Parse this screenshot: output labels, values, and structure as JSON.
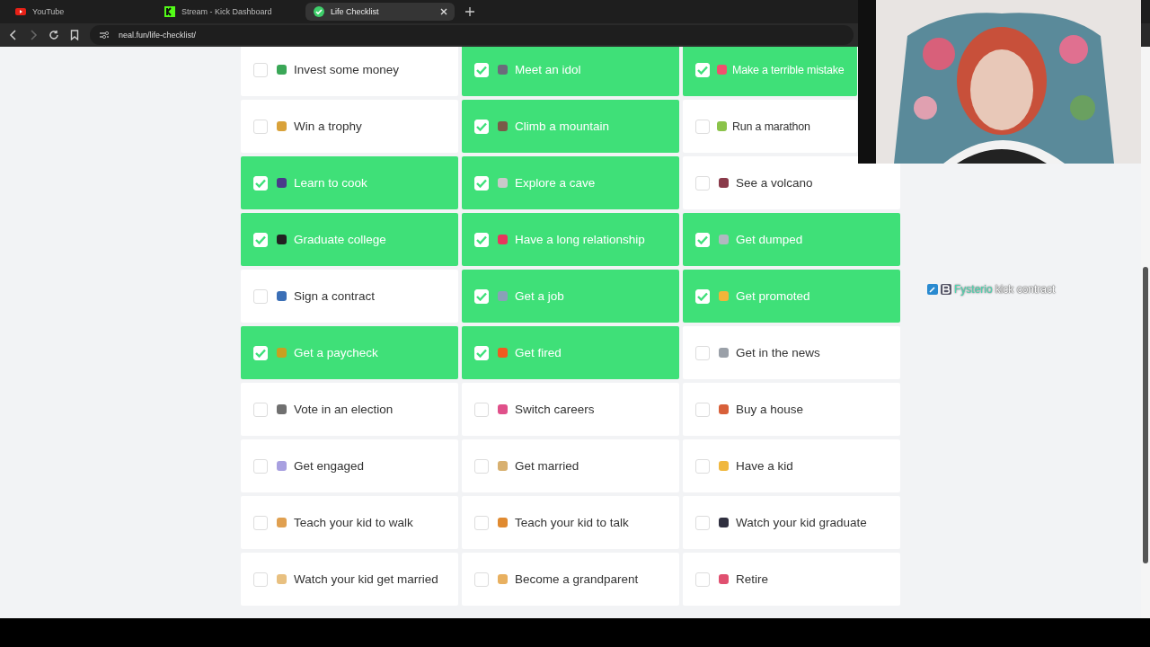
{
  "browser": {
    "tabs": [
      {
        "title": "YouTube",
        "selected": false,
        "kind": "youtube"
      },
      {
        "title": "Stream - Kick Dashboard",
        "selected": false,
        "kind": "kick"
      },
      {
        "title": "Life Checklist",
        "selected": true,
        "kind": "check"
      }
    ],
    "address": "neal.fun/life-checklist/"
  },
  "checklist": [
    {
      "label": "Invest some money",
      "checked": false,
      "color": "#3aa757"
    },
    {
      "label": "Meet an idol",
      "checked": true,
      "color": "#6b6b7b"
    },
    {
      "label": "Make a terrible mistake",
      "checked": true,
      "color": "#f0506e"
    },
    {
      "label": "Win a trophy",
      "checked": false,
      "color": "#d9a23a"
    },
    {
      "label": "Climb a mountain",
      "checked": true,
      "color": "#7a5a48"
    },
    {
      "label": "Run a marathon",
      "checked": false,
      "color": "#8bc34a"
    },
    {
      "label": "Learn to cook",
      "checked": true,
      "color": "#4a3a8a"
    },
    {
      "label": "Explore a cave",
      "checked": true,
      "color": "#c9c9c9"
    },
    {
      "label": "See a volcano",
      "checked": false,
      "color": "#8a3a4a"
    },
    {
      "label": "Graduate college",
      "checked": true,
      "color": "#222222"
    },
    {
      "label": "Have a long relationship",
      "checked": true,
      "color": "#e8365d"
    },
    {
      "label": "Get dumped",
      "checked": true,
      "color": "#b0b8c0"
    },
    {
      "label": "Sign a contract",
      "checked": false,
      "color": "#3b6fb6"
    },
    {
      "label": "Get a job",
      "checked": true,
      "color": "#8aa0b8"
    },
    {
      "label": "Get promoted",
      "checked": true,
      "color": "#f2b53a"
    },
    {
      "label": "Get a paycheck",
      "checked": true,
      "color": "#c8a020"
    },
    {
      "label": "Get fired",
      "checked": true,
      "color": "#f05a20"
    },
    {
      "label": "Get in the news",
      "checked": false,
      "color": "#9aa0a8"
    },
    {
      "label": "Vote in an election",
      "checked": false,
      "color": "#707070"
    },
    {
      "label": "Switch careers",
      "checked": false,
      "color": "#e0508a"
    },
    {
      "label": "Buy a house",
      "checked": false,
      "color": "#d8603a"
    },
    {
      "label": "Get engaged",
      "checked": false,
      "color": "#a8a0e0"
    },
    {
      "label": "Get married",
      "checked": false,
      "color": "#d8b070"
    },
    {
      "label": "Have a kid",
      "checked": false,
      "color": "#f0b840"
    },
    {
      "label": "Teach your kid to walk",
      "checked": false,
      "color": "#e0a050"
    },
    {
      "label": "Teach your kid to talk",
      "checked": false,
      "color": "#e08a30"
    },
    {
      "label": "Watch your kid graduate",
      "checked": false,
      "color": "#303040"
    },
    {
      "label": "Watch your kid get married",
      "checked": false,
      "color": "#e8c080"
    },
    {
      "label": "Become a grandparent",
      "checked": false,
      "color": "#e8b060"
    },
    {
      "label": "Retire",
      "checked": false,
      "color": "#e05070"
    }
  ],
  "chat_message": {
    "user": "Fysterio",
    "text": "kick contract"
  }
}
